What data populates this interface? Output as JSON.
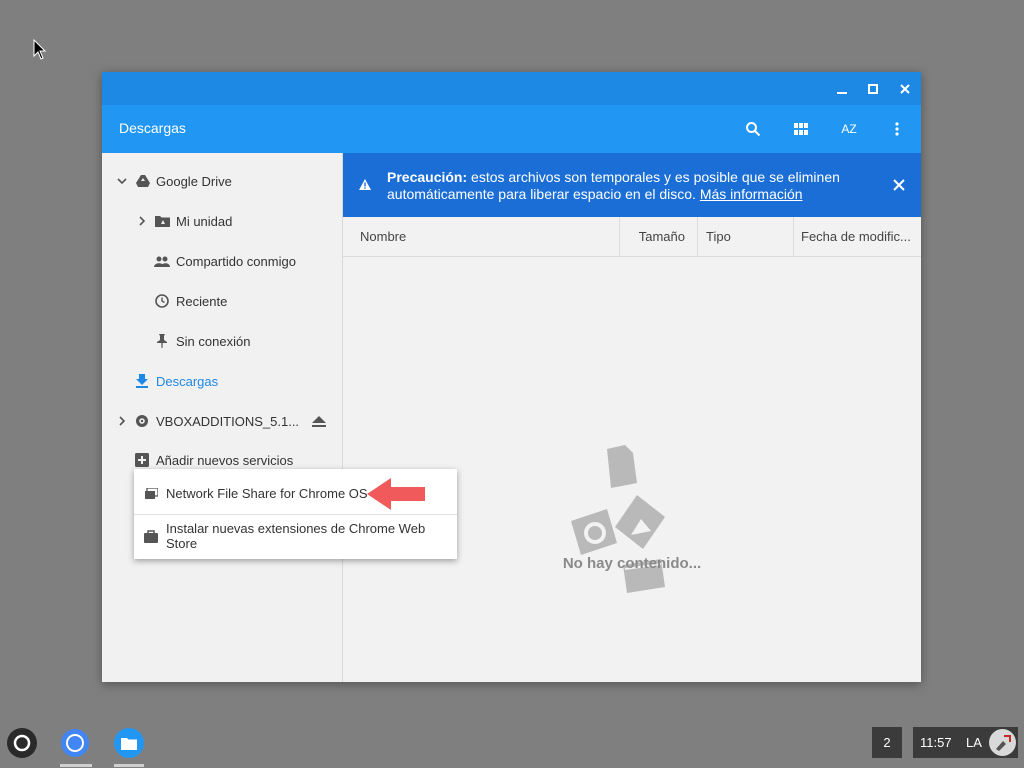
{
  "window": {
    "title": "Descargas",
    "controls": [
      "minimize",
      "maximize",
      "close"
    ],
    "toolbar": {
      "icons": [
        "search-icon",
        "grid-view-icon",
        "sort-icon",
        "more-vert-icon"
      ],
      "sort_label": "AZ"
    }
  },
  "sidebar": {
    "items": [
      {
        "label": "Google Drive",
        "icon": "google-drive-icon",
        "expanded": true
      },
      {
        "label": "Mi unidad",
        "icon": "folder-drive-icon"
      },
      {
        "label": "Compartido conmigo",
        "icon": "people-icon"
      },
      {
        "label": "Reciente",
        "icon": "clock-icon"
      },
      {
        "label": "Sin conexión",
        "icon": "pin-icon"
      },
      {
        "label": "Descargas",
        "icon": "download-icon",
        "active": true
      },
      {
        "label": "VBOXADDITIONS_5.1...",
        "icon": "disc-icon"
      },
      {
        "label": "Añadir nuevos servicios",
        "icon": "add-box-icon"
      }
    ]
  },
  "banner": {
    "bold": "Precaución:",
    "text": " estos archivos son temporales y es posible que se eliminen automáticamente para liberar espacio en el disco. ",
    "link": "Más información"
  },
  "columns": [
    "Nombre",
    "Tamaño",
    "Tipo",
    "Fecha de modific..."
  ],
  "empty_text": "No hay contenido...",
  "menu": {
    "items": [
      {
        "label": "Network File Share for Chrome OS",
        "icon": "network-share-icon"
      },
      {
        "label": "Instalar nuevas extensiones de Chrome Web Store",
        "icon": "web-store-icon"
      }
    ]
  },
  "shelf": {
    "tray_count": "2",
    "time": "11:57",
    "ime": "LA"
  },
  "colors": {
    "titlebar": "#1e88e5",
    "toolbar": "#2196f3",
    "banner": "#1b6ed6",
    "accent": "#1e88e5",
    "arrow": "#f05a5a"
  }
}
